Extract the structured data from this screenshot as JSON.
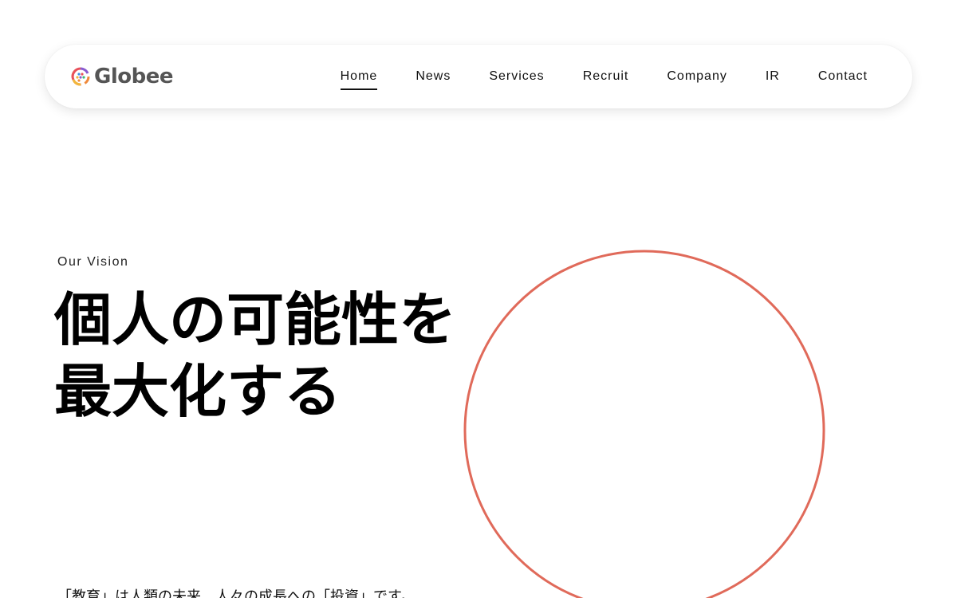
{
  "header": {
    "logo_text": "Globee",
    "nav": [
      {
        "label": "Home",
        "active": true
      },
      {
        "label": "News"
      },
      {
        "label": "Services"
      },
      {
        "label": "Recruit"
      },
      {
        "label": "Company"
      },
      {
        "label": "IR"
      },
      {
        "label": "Contact"
      }
    ]
  },
  "hero": {
    "eyebrow": "Our Vision",
    "headline_line1": "個人の可能性を",
    "headline_line2": "最大化する",
    "body": "「教育」は人類の未来、人々の成長への「投資」です。"
  },
  "colors": {
    "accent": "#e06a5a",
    "text": "#111111",
    "logo_text": "#555555"
  },
  "icons": {
    "logo": "globee-logo-icon"
  }
}
